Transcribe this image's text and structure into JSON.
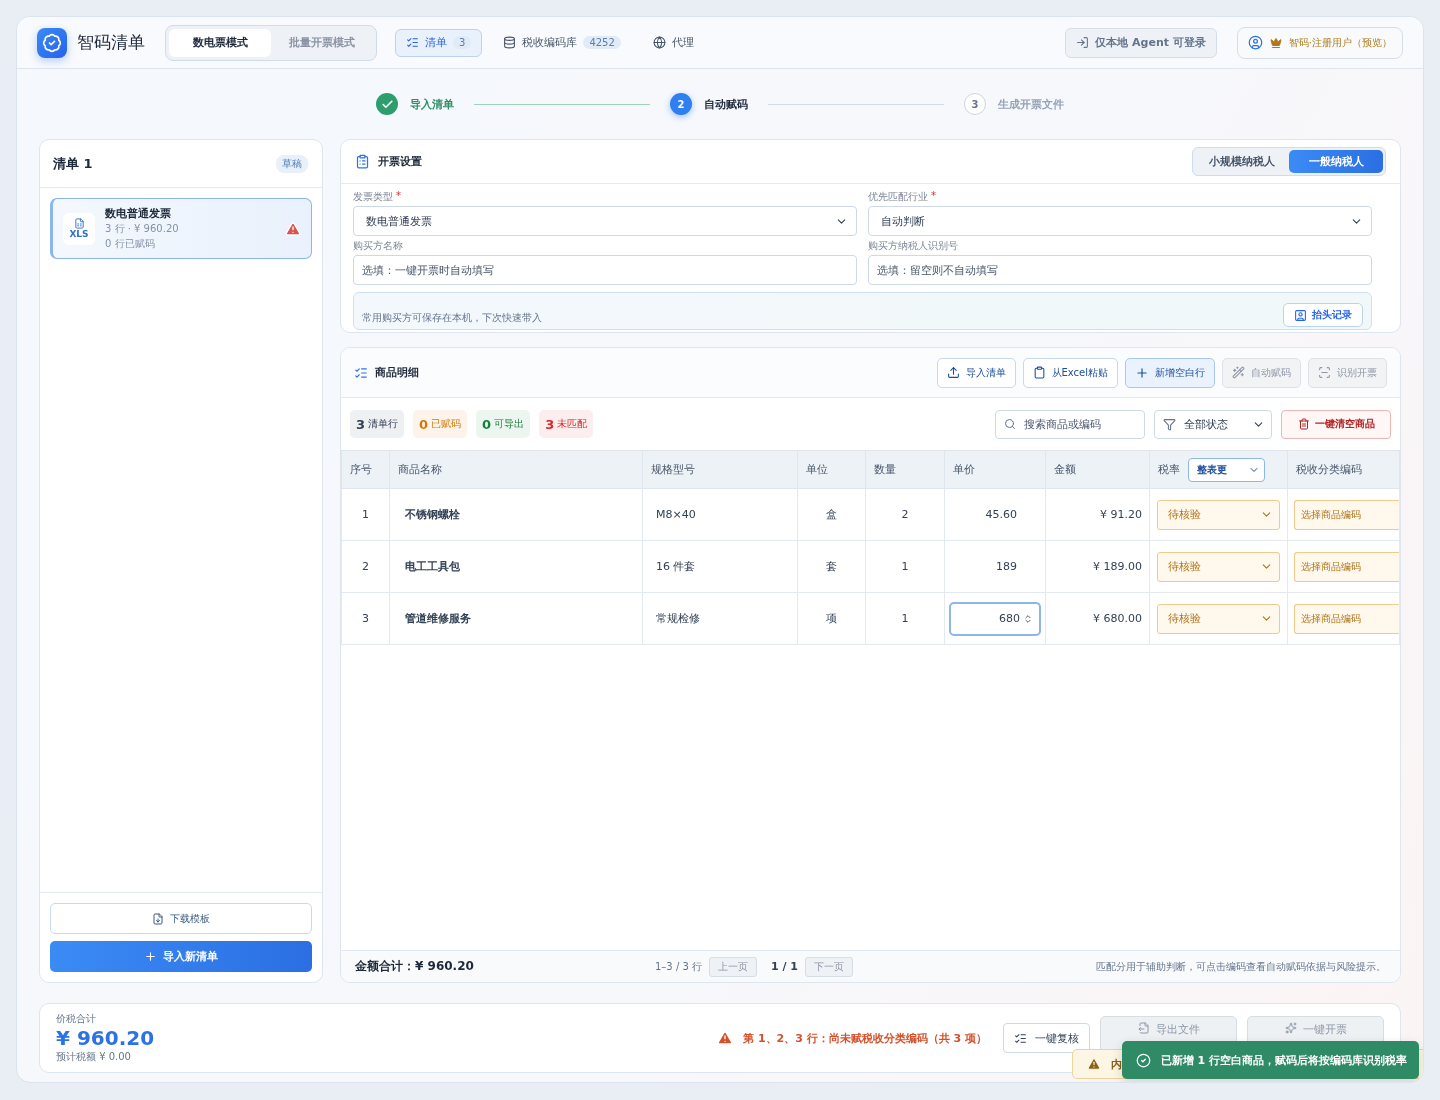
{
  "app": {
    "title": "智码清单"
  },
  "modes": [
    {
      "label": "数电票模式",
      "selected": true
    },
    {
      "label": "批量开票模式",
      "selected": false
    }
  ],
  "nav": [
    {
      "kind": "list",
      "label": "清单",
      "count": "3",
      "selected": true
    },
    {
      "kind": "database",
      "label": "税收编码库",
      "count": "4252",
      "selected": false
    },
    {
      "kind": "globe",
      "label": "代理",
      "selected": false
    }
  ],
  "login_button": "仅本地 Agent 可登录",
  "user": {
    "label": "智码·注册用户（预览）"
  },
  "steps": [
    {
      "label": "导入清单",
      "done": true,
      "selected": false
    },
    {
      "number": "2",
      "label": "自动赋码",
      "done": false,
      "selected": true
    },
    {
      "number": "3",
      "label": "生成开票文件",
      "done": false,
      "selected": false
    }
  ],
  "sidebar": {
    "title": "清单 1",
    "badge": "草稿",
    "files": [
      {
        "name": "数电普通发票",
        "meta": "3 行 · ¥ 960.20",
        "coded": "0 行已赋码",
        "file_type": "XLS",
        "warning": true,
        "selected": true
      }
    ],
    "download_button": "下载模板",
    "import_button": "导入新清单"
  },
  "settings": {
    "title": "开票设置",
    "taxpayer_types": [
      {
        "label": "小规模纳税人",
        "selected": false
      },
      {
        "label": "一般纳税人",
        "selected": true
      }
    ],
    "fields": [
      {
        "kind": "select",
        "label": "发票类型",
        "required_mark": "*",
        "value": "数电普通发票"
      },
      {
        "kind": "select",
        "label": "优先匹配行业",
        "required_mark": "*",
        "value": "自动判断"
      },
      {
        "kind": "input",
        "label": "购买方名称",
        "placeholder": "选填：一键开票时自动填写"
      },
      {
        "kind": "input",
        "label": "购买方纳税人识别号",
        "placeholder": "选填：留空则不自动填写"
      }
    ],
    "tip": "常用购买方可保存在本机，下次快速带入",
    "tip_button": "抬头记录"
  },
  "goods": {
    "title": "商品明细",
    "actions": [
      {
        "kind": "upload",
        "label": "导入清单",
        "disabled": false,
        "primary": false
      },
      {
        "kind": "clipboard",
        "label": "从Excel粘贴",
        "disabled": false,
        "primary": false
      },
      {
        "kind": "plus",
        "label": "新增空白行",
        "disabled": false,
        "primary": true
      },
      {
        "kind": "wand",
        "label": "自动赋码",
        "disabled": true,
        "primary": false
      },
      {
        "kind": "scan",
        "label": "识别开票",
        "disabled": true,
        "primary": false
      }
    ],
    "stats": [
      {
        "value": "3",
        "label": "清单行",
        "color": "#334155"
      },
      {
        "value": "0",
        "label": "已赋码",
        "color": "#d97706"
      },
      {
        "value": "0",
        "label": "可导出",
        "color": "#15803d"
      },
      {
        "value": "3",
        "label": "未匹配",
        "color": "#dc2626"
      }
    ],
    "search": {
      "placeholder": "搜索商品或编码"
    },
    "status_filter": "全部状态",
    "clear_button": "一键清空商品",
    "columns": [
      "序号",
      "商品名称",
      "规格型号",
      "单位",
      "数量",
      "单价",
      "金额",
      "税率",
      "税收分类编码"
    ],
    "rate_select": "整表更",
    "rows": [
      {
        "index": "1",
        "name": "不锈钢螺栓",
        "spec": "M8×40",
        "unit": "盒",
        "qty": "2",
        "price": "45.60",
        "amount": "¥ 91.20",
        "rate": "待核验",
        "code": "选择商品编码",
        "editing": false
      },
      {
        "index": "2",
        "name": "电工工具包",
        "spec": "16 件套",
        "unit": "套",
        "qty": "1",
        "price": "189",
        "amount": "¥ 189.00",
        "rate": "待核验",
        "code": "选择商品编码",
        "editing": false
      },
      {
        "index": "3",
        "name": "管道维修服务",
        "spec": "常规检修",
        "unit": "项",
        "qty": "1",
        "price": "680",
        "amount": "¥ 680.00",
        "rate": "待核验",
        "code": "选择商品编码",
        "editing": true
      }
    ],
    "total": "金额合计：¥ 960.20",
    "range": "1–3 / 3 行",
    "prev": "上一页",
    "page": "1 / 1",
    "next": "下一页",
    "note": "匹配分用于辅助判断，可点击编码查看自动赋码依据与风险提示。"
  },
  "footer": {
    "total_label": "价税合计",
    "total": "¥ 960.20",
    "tax": "预计税额 ¥ 0.00",
    "warning": "第 1、2、3 行：尚未赋税收分类编码（共 3 项）",
    "review_button": "一键复核",
    "export_button": "导出文件",
    "issue_button": "一键开票"
  },
  "toasts": [
    {
      "kind": "warning",
      "text": "内"
    },
    {
      "kind": "success",
      "text": "已新增 1 行空白商品，赋码后将按编码库识别税率"
    }
  ]
}
